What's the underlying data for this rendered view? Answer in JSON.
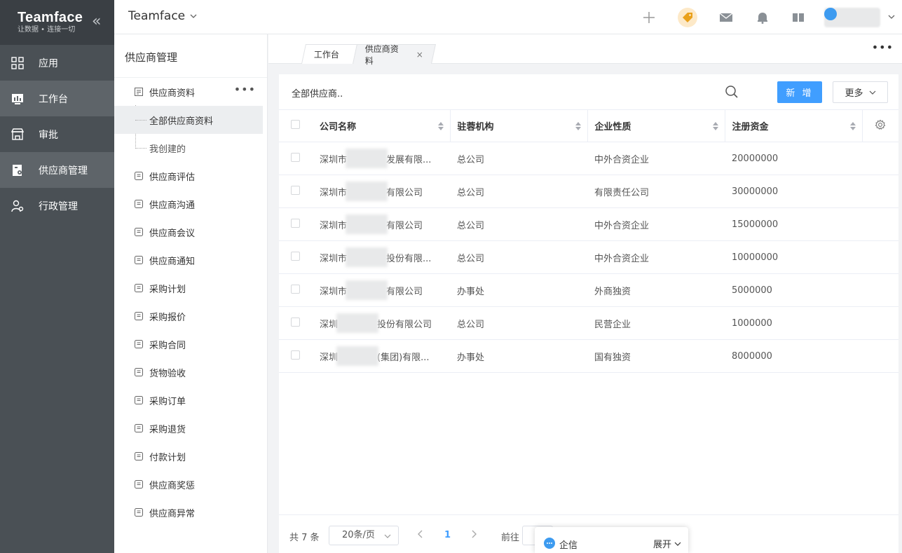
{
  "brand": {
    "title": "Teamface",
    "subtitle": "让数据 • 连接一切"
  },
  "main_nav": [
    {
      "label": "应用",
      "icon": "apps-grid-icon",
      "active": false
    },
    {
      "label": "工作台",
      "icon": "dashboard-icon",
      "active": true
    },
    {
      "label": "审批",
      "icon": "approval-icon",
      "active": false
    },
    {
      "label": "供应商管理",
      "icon": "supplier-icon",
      "active": true
    },
    {
      "label": "行政管理",
      "icon": "admin-people-icon",
      "active": false
    }
  ],
  "header": {
    "app_name": "Teamface"
  },
  "sub_sidebar": {
    "title": "供应商管理",
    "supplier_info": "供应商资料",
    "children": [
      "全部供应商资料",
      "我创建的"
    ],
    "items": [
      {
        "label": "供应商评估",
        "icon": "evaluate-icon"
      },
      {
        "label": "供应商沟通",
        "icon": "chat-face-icon"
      },
      {
        "label": "供应商会议",
        "icon": "meeting-icon"
      },
      {
        "label": "供应商通知",
        "icon": "notice-icon"
      },
      {
        "label": "采购计划",
        "icon": "cart-icon"
      },
      {
        "label": "采购报价",
        "icon": "quote-icon"
      },
      {
        "label": "采购合同",
        "icon": "contract-icon"
      },
      {
        "label": "货物验收",
        "icon": "inspect-icon"
      },
      {
        "label": "采购订单",
        "icon": "order-icon"
      },
      {
        "label": "采购退货",
        "icon": "return-cart-icon"
      },
      {
        "label": "付款计划",
        "icon": "money-bag-icon"
      },
      {
        "label": "供应商奖惩",
        "icon": "reward-icon"
      },
      {
        "label": "供应商异常",
        "icon": "calendar-grid-icon"
      }
    ]
  },
  "tabs": [
    {
      "label": "工作台"
    },
    {
      "label": "供应商资料",
      "close": "×"
    }
  ],
  "toolbar": {
    "filter_title": "全部供应商..",
    "add_label": "新 增",
    "more_label": "更多"
  },
  "table": {
    "columns": [
      "公司名称",
      "驻蓉机构",
      "企业性质",
      "注册资金"
    ],
    "rows": [
      {
        "name_pre": "深圳市",
        "name_post": "发展有限...",
        "org": "总公司",
        "nature": "中外合资企业",
        "capital": "20000000"
      },
      {
        "name_pre": "深圳市",
        "name_post": "有限公司",
        "org": "总公司",
        "nature": "有限责任公司",
        "capital": "30000000"
      },
      {
        "name_pre": "深圳市",
        "name_post": "有限公司",
        "org": "总公司",
        "nature": "中外合资企业",
        "capital": "15000000"
      },
      {
        "name_pre": "深圳市",
        "name_post": "投份有限...",
        "org": "总公司",
        "nature": "中外合资企业",
        "capital": "10000000"
      },
      {
        "name_pre": "深圳市",
        "name_post": "有限公司",
        "org": "办事处",
        "nature": "外商独资",
        "capital": "5000000"
      },
      {
        "name_pre": "深圳",
        "name_post": "投份有限公司",
        "org": "总公司",
        "nature": "民营企业",
        "capital": "1000000"
      },
      {
        "name_pre": "深圳",
        "name_post": "(集团)有限...",
        "org": "办事处",
        "nature": "国有独资",
        "capital": "8000000"
      }
    ]
  },
  "pager": {
    "total": "共 7 条",
    "page_size": "20条/页",
    "current_page": "1",
    "goto_label": "前往"
  },
  "chat": {
    "label": "企信",
    "expand": "展开"
  },
  "colors": {
    "sidebar_bg": "#4a5055",
    "brand_bg": "#3a3f44",
    "primary": "#409eff"
  }
}
